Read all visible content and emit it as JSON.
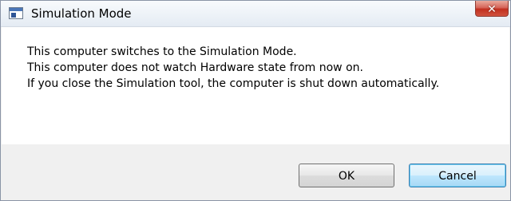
{
  "window": {
    "title": "Simulation Mode",
    "close_glyph": "✕"
  },
  "message": {
    "lines": [
      "This computer switches to the Simulation Mode.",
      "This computer does not watch Hardware state from now on.",
      "If you close the Simulation tool, the computer is shut down automatically."
    ]
  },
  "buttons": {
    "ok_label": "OK",
    "cancel_label": "Cancel"
  },
  "icons": {
    "title": "window-app-icon",
    "close": "close-icon"
  },
  "colors": {
    "close_button": "#c1301f",
    "focused_button_border": "#3c7fb1",
    "content_background": "#ffffff",
    "chrome_background": "#f0f0f0"
  }
}
